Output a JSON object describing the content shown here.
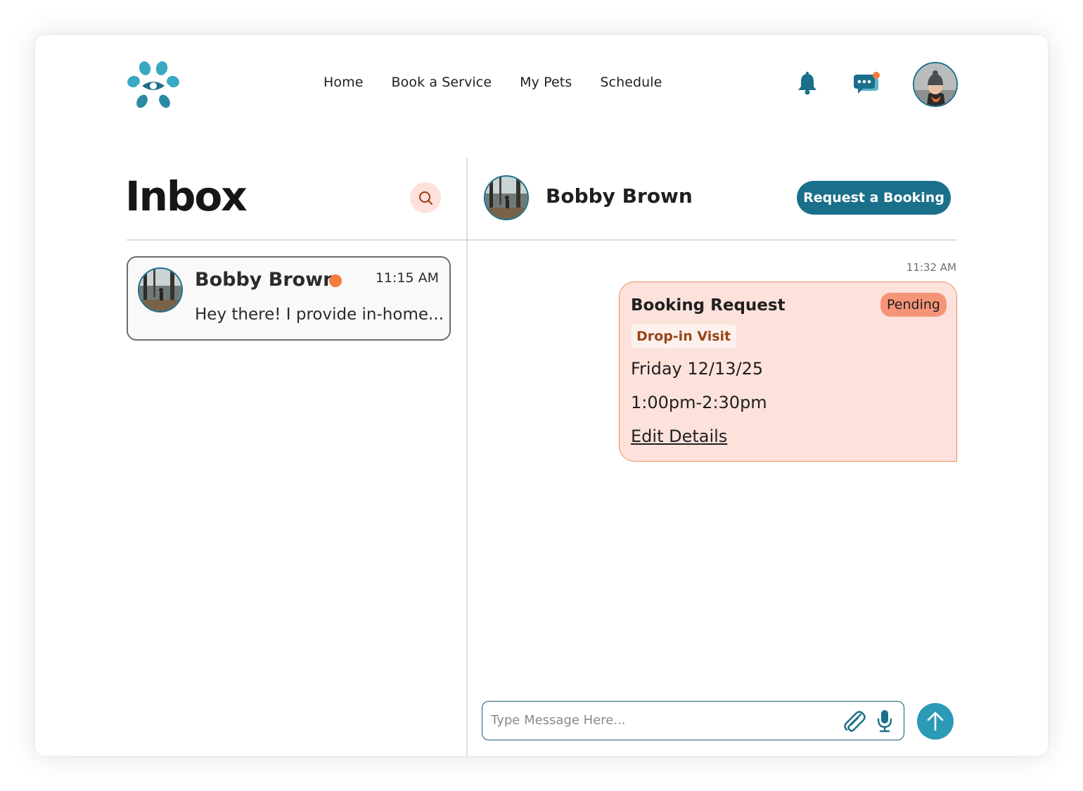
{
  "header": {
    "logo_icon": "paw-eye-logo",
    "nav": [
      "Home",
      "Book a Service",
      "My Pets",
      "Schedule"
    ],
    "icons": [
      "bell-icon",
      "chat-icon",
      "user-avatar"
    ],
    "chat_has_notification": true
  },
  "inbox": {
    "title": "Inbox",
    "search_icon": "search-icon",
    "conversations": [
      {
        "name": "Bobby Brown",
        "time": "11:15 AM",
        "preview": "Hey there! I provide in-home...",
        "unread": true
      }
    ]
  },
  "chat": {
    "contact_name": "Bobby Brown",
    "request_button": "Request a Booking",
    "message_time": "11:32 AM",
    "booking": {
      "title": "Booking Request",
      "status": "Pending",
      "service": "Drop-in Visit",
      "date": "Friday 12/13/25",
      "time": "1:00pm-2:30pm",
      "edit_link": "Edit Details"
    },
    "composer": {
      "placeholder": "Type Message Here...",
      "icons": [
        "paperclip-icon",
        "microphone-icon",
        "send-arrow-icon"
      ]
    }
  },
  "colors": {
    "brand_teal": "#1a6f8a",
    "send_teal": "#2a9ab6",
    "accent_orange": "#f47c3c",
    "booking_bg": "#fde2dc",
    "pending_badge": "#f69478",
    "search_bg": "#fde1da"
  }
}
